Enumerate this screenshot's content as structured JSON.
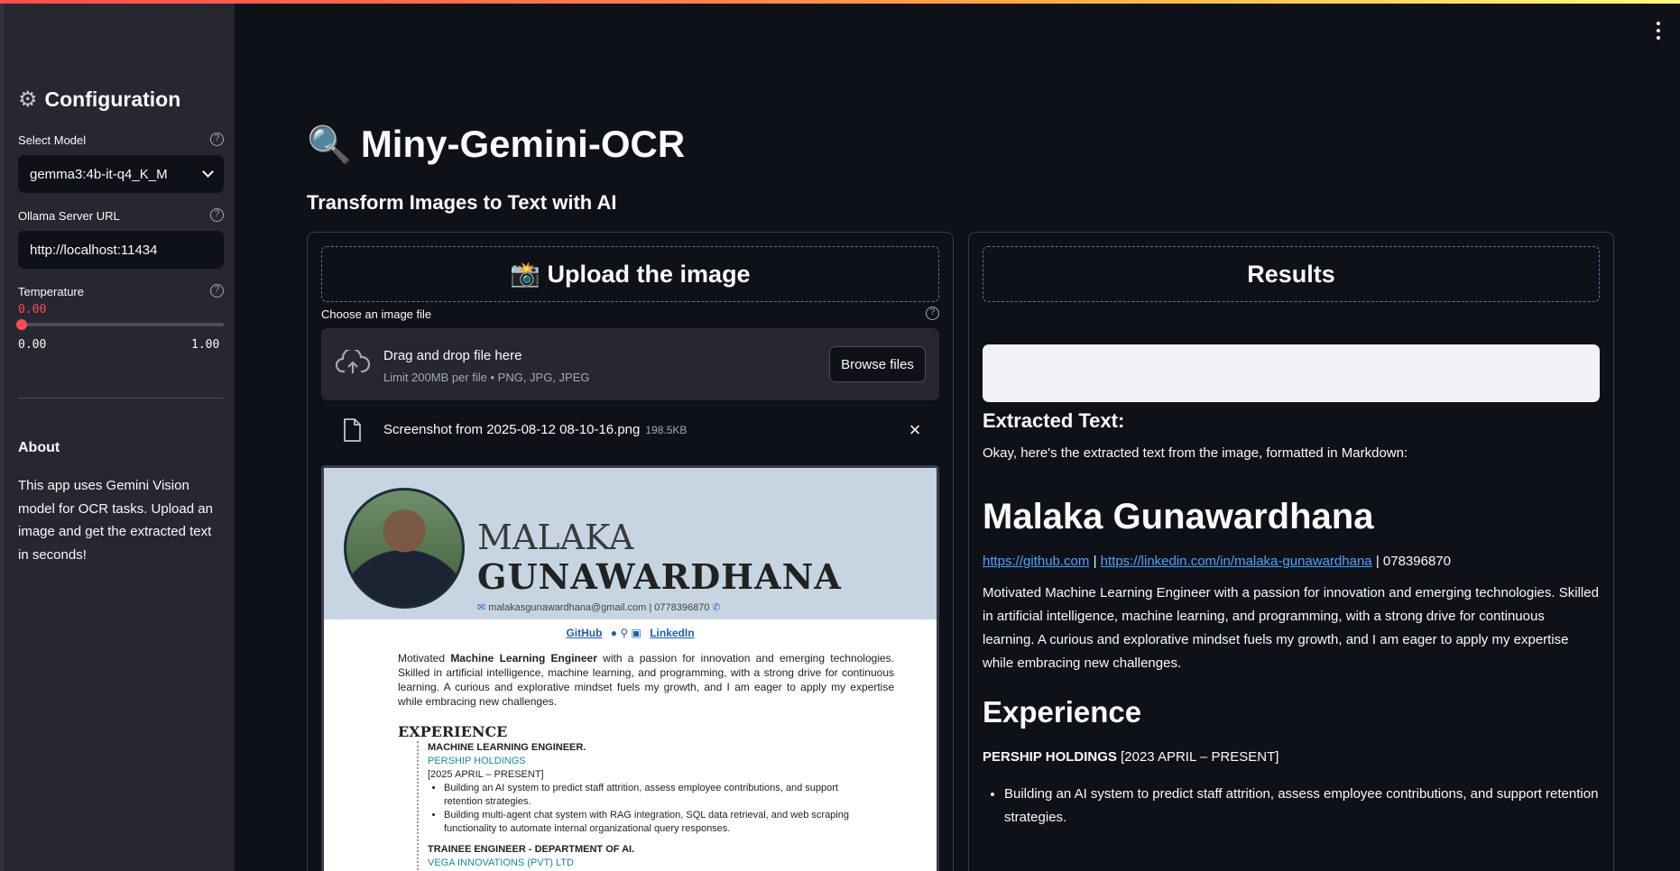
{
  "sidebar": {
    "title": "Configuration",
    "icon": "gear-icon",
    "model_label": "Select Model",
    "model_value": "gemma3:4b-it-q4_K_M",
    "url_label": "Ollama Server URL",
    "url_value": "http://localhost:11434",
    "temperature_label": "Temperature",
    "temperature_value": "0.00",
    "temperature_min": "0.00",
    "temperature_max": "1.00",
    "temperature_level": 0,
    "about_title": "About",
    "about_text": "This app uses Gemini Vision model for OCR tasks. Upload an image and get the extracted text in seconds!"
  },
  "main": {
    "title": "Miny-Gemini-OCR",
    "subtitle": "Transform Images to Text with AI"
  },
  "upload": {
    "header": "📸 Upload the image",
    "choose_label": "Choose an image file",
    "drop_text": "Drag and drop file here",
    "limit_text": "Limit 200MB per file • PNG, JPG, JPEG",
    "browse_label": "Browse files",
    "file_name": "Screenshot from 2025-08-12 08-10-16.png",
    "file_size": "198.5KB"
  },
  "preview": {
    "first_name": "MALAKA",
    "last_name": "GUNAWARDHANA",
    "contact": "malakasgunawardhana@gmail.com | 0778396870",
    "link_github": "GitHub",
    "link_linkedin": "LinkedIn",
    "summary_pre": "Motivated ",
    "summary_bold": "Machine Learning Engineer",
    "summary_post": " with a passion for innovation and emerging technologies. Skilled in artificial intelligence, machine learning, and programming, with a strong drive for continuous learning. A curious and explorative mindset fuels my growth, and I am eager to apply my expertise while embracing new challenges.",
    "exp_title": "EXPERIENCE",
    "role1": "MACHINE LEARNING ENGINEER.",
    "company1": "PERSHIP HOLDINGS",
    "dates1": "[2025 APRIL – PRESENT]",
    "bullet1": "Building an AI system to predict staff attrition, assess employee contributions, and support retention strategies.",
    "bullet2": "Building multi-agent chat system with RAG integration, SQL data retrieval, and web scraping functionality to automate internal organizational query responses.",
    "role2": "TRAINEE ENGINEER - DEPARTMENT OF AI.",
    "company2": "VEGA INNOVATIONS (PVT) LTD"
  },
  "results": {
    "header": "Results",
    "extracted_title": "Extracted Text:",
    "intro": "Okay, here's the extracted text from the image, formatted in Markdown:",
    "name": "Malaka Gunawardhana",
    "link1": "https://github.com",
    "sep": " | ",
    "link2": "https://linkedin.com/in/malaka-gunawardhana",
    "phone": " | 078396870",
    "summary": "Motivated Machine Learning Engineer with a passion for innovation and emerging technologies. Skilled in artificial intelligence, machine learning, and programming, with a strong drive for continuous learning. A curious and explorative mindset fuels my growth, and I am eager to apply my expertise while embracing new challenges.",
    "section": "Experience",
    "company": "PERSHIP HOLDINGS",
    "dates": " [2023 APRIL – PRESENT]",
    "bullet1": "Building an AI system to predict staff attrition, assess employee contributions, and support retention strategies."
  },
  "colors": {
    "background": "#0e1117",
    "sidebar": "#262730",
    "accent": "#ff4b4b",
    "link": "#4da3ff",
    "dash_border": "#3d7db8"
  }
}
